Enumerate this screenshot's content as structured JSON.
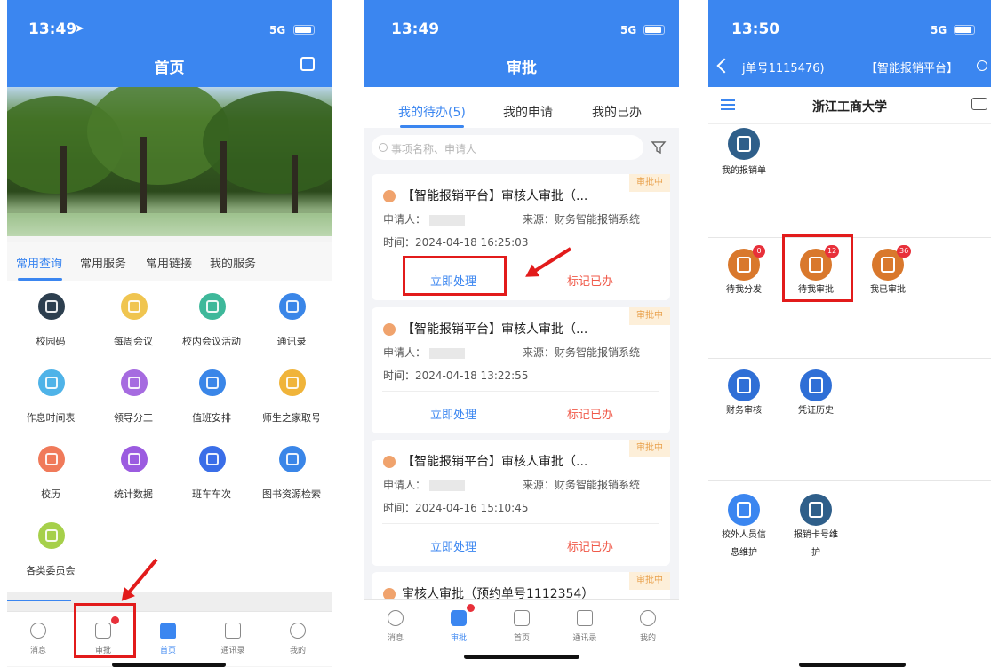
{
  "phone1": {
    "time": "13:49",
    "network": "5G",
    "title": "首页",
    "tabs": [
      "常用查询",
      "常用服务",
      "常用链接",
      "我的服务"
    ],
    "grid": [
      {
        "label": "校园码",
        "color": "#2d3f4f"
      },
      {
        "label": "每周会议",
        "color": "#f0c550"
      },
      {
        "label": "校内会议活动",
        "color": "#3eb89a"
      },
      {
        "label": "通讯录",
        "color": "#3a86e8"
      },
      {
        "label": "作息时间表",
        "color": "#4fb3e8"
      },
      {
        "label": "领导分工",
        "color": "#a66be0"
      },
      {
        "label": "值班安排",
        "color": "#3a86e8"
      },
      {
        "label": "师生之家取号",
        "color": "#f0b43a"
      },
      {
        "label": "校历",
        "color": "#f07a5a"
      },
      {
        "label": "统计数据",
        "color": "#9b5be0"
      },
      {
        "label": "班车车次",
        "color": "#3a6ee8"
      },
      {
        "label": "图书资源检索",
        "color": "#3a86e8"
      },
      {
        "label": "各类委员会",
        "color": "#a6d04a"
      }
    ],
    "bottom": [
      "消息",
      "审批",
      "首页",
      "通讯录",
      "我的"
    ]
  },
  "phone2": {
    "time": "13:49",
    "network": "5G",
    "title": "审批",
    "tabs": [
      "我的待办(5)",
      "我的申请",
      "我的已办"
    ],
    "search_placeholder": "事项名称、申请人",
    "cards": [
      {
        "title": "【智能报销平台】审核人审批（...",
        "status": "审批中",
        "applicant": "申请人：",
        "source": "来源：财务智能报销系统",
        "time": "时间：2024-04-18 16:25:03",
        "action1": "立即处理",
        "action2": "标记已办"
      },
      {
        "title": "【智能报销平台】审核人审批（...",
        "status": "审批中",
        "applicant": "申请人：",
        "source": "来源：财务智能报销系统",
        "time": "时间：2024-04-18 13:22:55",
        "action1": "立即处理",
        "action2": "标记已办"
      },
      {
        "title": "【智能报销平台】审核人审批（...",
        "status": "审批中",
        "applicant": "申请人：",
        "source": "来源：财务智能报销系统",
        "time": "时间：2024-04-16 15:10:45",
        "action1": "立即处理",
        "action2": "标记已办"
      },
      {
        "title": "审核人审批（预约单号1112354）",
        "status": "审批中"
      }
    ],
    "bottom": [
      "消息",
      "审批",
      "首页",
      "通讯录",
      "我的"
    ]
  },
  "phone3": {
    "time": "13:50",
    "network": "5G",
    "nav_left": "j单号1115476)",
    "nav_right": "【智能报销平台】",
    "title": "浙江工商大学",
    "items": {
      "my_reimburse": "我的报销单",
      "pending_dispatch": "待我分发",
      "pending_dispatch_count": "0",
      "pending_approve": "待我审批",
      "pending_approve_count": "12",
      "approved": "我已审批",
      "approved_count": "36",
      "finance_review": "财务审核",
      "voucher_history": "凭证历史",
      "external_info_1": "校外人员信",
      "external_info_2": "息维护",
      "card_maint_1": "报销卡号维",
      "card_maint_2": "护"
    }
  }
}
